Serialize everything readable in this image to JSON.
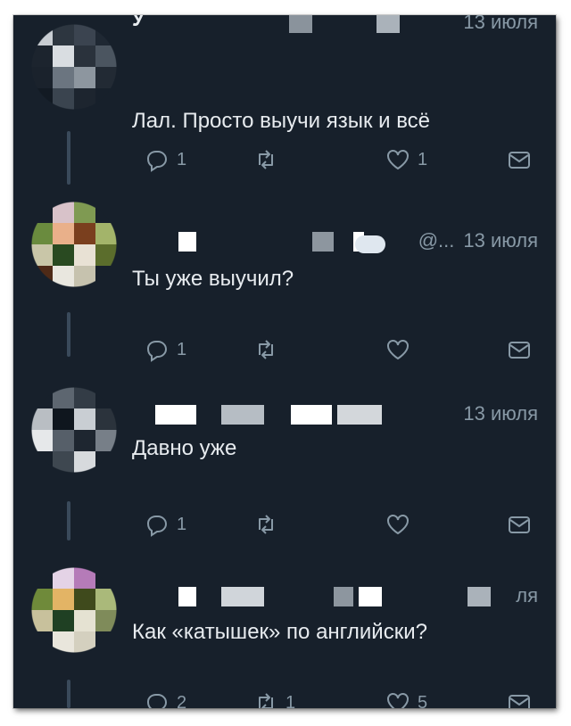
{
  "tweets": [
    {
      "time": "13 июля",
      "handle": "",
      "name_fragment": "У",
      "text": "Лал. Просто выучи язык и всё",
      "replies": "1",
      "retweets": "",
      "likes": "1"
    },
    {
      "time": "13 июля",
      "handle": "@...",
      "text": "Ты уже выучил?",
      "replies": "1",
      "retweets": "",
      "likes": ""
    },
    {
      "time": "13 июля",
      "handle": "",
      "text": "Давно уже",
      "replies": "1",
      "retweets": "",
      "likes": ""
    },
    {
      "time": "ля",
      "handle": "",
      "text": "Как «катышек» по английски?",
      "replies": "2",
      "retweets": "1",
      "likes": "5"
    }
  ],
  "colors": {
    "background": "#17202b",
    "text": "#e7ebef",
    "secondary": "#8899a6",
    "thread_line": "#3a4a5b"
  },
  "icons": [
    "reply-icon",
    "retweet-icon",
    "like-icon",
    "direct-message-icon"
  ]
}
